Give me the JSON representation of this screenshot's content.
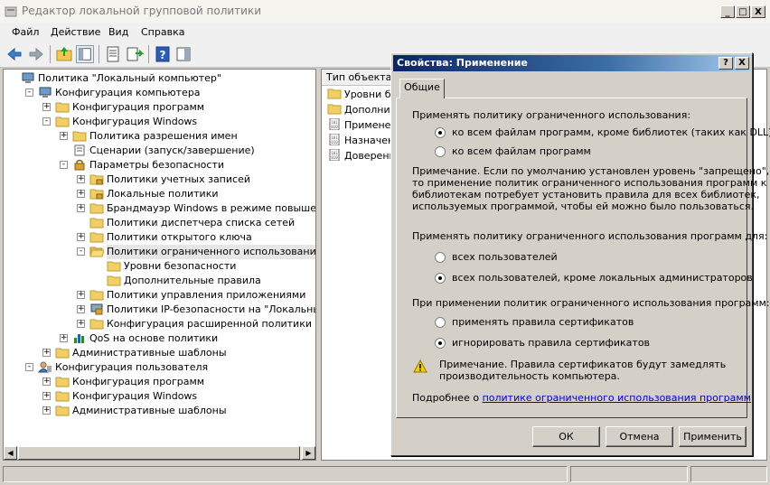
{
  "window": {
    "title": "Редактор локальной групповой политики",
    "minimize": "_",
    "maximize": "□",
    "close": "X"
  },
  "menu": [
    "Файл",
    "Действие",
    "Вид",
    "Справка"
  ],
  "toolbar_icons": [
    "back-icon",
    "forward-icon",
    "up-folder-icon",
    "show-hide-tree-icon",
    "properties-icon",
    "export-list-icon",
    "help-icon",
    "show-action-pane-icon"
  ],
  "tree": [
    {
      "label": "Политика \"Локальный компьютер\"",
      "depth": 0,
      "expander": "",
      "icon": "computer-icon"
    },
    {
      "label": "Конфигурация компьютера",
      "depth": 1,
      "expander": "-",
      "icon": "computer-icon"
    },
    {
      "label": "Конфигурация программ",
      "depth": 2,
      "expander": "+",
      "icon": "folder-icon"
    },
    {
      "label": "Конфигурация Windows",
      "depth": 2,
      "expander": "-",
      "icon": "folder-icon"
    },
    {
      "label": "Политика разрешения имен",
      "depth": 3,
      "expander": "+",
      "icon": "folder-icon"
    },
    {
      "label": "Сценарии (запуск/завершение)",
      "depth": 3,
      "expander": "",
      "icon": "script-icon"
    },
    {
      "label": "Параметры безопасности",
      "depth": 3,
      "expander": "-",
      "icon": "security-icon"
    },
    {
      "label": "Политики учетных записей",
      "depth": 4,
      "expander": "+",
      "icon": "folder-lock-icon"
    },
    {
      "label": "Локальные политики",
      "depth": 4,
      "expander": "+",
      "icon": "folder-lock-icon"
    },
    {
      "label": "Брандмауэр Windows в режиме повышенной без",
      "depth": 4,
      "expander": "+",
      "icon": "folder-icon"
    },
    {
      "label": "Политики диспетчера списка сетей",
      "depth": 4,
      "expander": "",
      "icon": "folder-icon"
    },
    {
      "label": "Политики открытого ключа",
      "depth": 4,
      "expander": "+",
      "icon": "folder-icon"
    },
    {
      "label": "Политики ограниченного использования програ",
      "depth": 4,
      "expander": "-",
      "icon": "folder-open-icon",
      "selected": true
    },
    {
      "label": "Уровни безопасности",
      "depth": 5,
      "expander": "",
      "icon": "folder-icon"
    },
    {
      "label": "Дополнительные правила",
      "depth": 5,
      "expander": "",
      "icon": "folder-icon"
    },
    {
      "label": "Политики управления приложениями",
      "depth": 4,
      "expander": "+",
      "icon": "folder-icon"
    },
    {
      "label": "Политики IP-безопасности на \"Локальный компь",
      "depth": 4,
      "expander": "+",
      "icon": "ipsec-icon"
    },
    {
      "label": "Конфигурация расширенной политики аудита",
      "depth": 4,
      "expander": "+",
      "icon": "folder-icon"
    },
    {
      "label": "QoS на основе политики",
      "depth": 3,
      "expander": "+",
      "icon": "chart-icon"
    },
    {
      "label": "Административные шаблоны",
      "depth": 2,
      "expander": "+",
      "icon": "folder-icon"
    },
    {
      "label": "Конфигурация пользователя",
      "depth": 1,
      "expander": "-",
      "icon": "user-icon"
    },
    {
      "label": "Конфигурация программ",
      "depth": 2,
      "expander": "+",
      "icon": "folder-icon"
    },
    {
      "label": "Конфигурация Windows",
      "depth": 2,
      "expander": "+",
      "icon": "folder-icon"
    },
    {
      "label": "Административные шаблоны",
      "depth": 2,
      "expander": "+",
      "icon": "folder-icon"
    }
  ],
  "list": {
    "column_header": "Тип объекта",
    "items": [
      {
        "label": "Уровни безо",
        "icon": "folder-icon"
      },
      {
        "label": "Дополните",
        "icon": "folder-icon"
      },
      {
        "label": "Применени",
        "icon": "policy-file-icon"
      },
      {
        "label": "Назначенн",
        "icon": "policy-file-icon"
      },
      {
        "label": "Доверенн",
        "icon": "policy-file-icon"
      }
    ]
  },
  "dialog": {
    "title": "Свойства: Применение",
    "help": "?",
    "close": "X",
    "tab": "Общие",
    "section1_label": "Применять политику ограниченного использования:",
    "radio1a": "ко всем файлам программ, кроме библиотек (таких как DLL)",
    "radio1b": "ко всем файлам программ",
    "note1": [
      "Примечание. Если по умолчанию установлен уровень \"запрещено\",",
      "то применение политик ограниченного использования программ к",
      "библиотекам потребует установить правила для всех библиотек,",
      "используемых  программой, чтобы ей можно было пользоваться."
    ],
    "section2_label": "Применять политику ограниченного использования программ для:",
    "radio2a": "всех пользователей",
    "radio2b": "всех пользователей, кроме локальных администраторов",
    "section3_label": "При применении политик ограниченного использования программ:",
    "radio3a": "применять правила сертификатов",
    "radio3b": "игнорировать правила сертификатов",
    "warning": [
      "Примечание. Правила сертификатов будут замедлять",
      "производительность компьютера."
    ],
    "more_prefix": "Подробнее о ",
    "more_link": "политике ограниченного использования программ",
    "ok": "ОК",
    "cancel": "Отмена",
    "apply": "Применить",
    "selected": {
      "enforcement": "radio1a",
      "users": "radio2b",
      "certificates": "radio3b"
    }
  }
}
